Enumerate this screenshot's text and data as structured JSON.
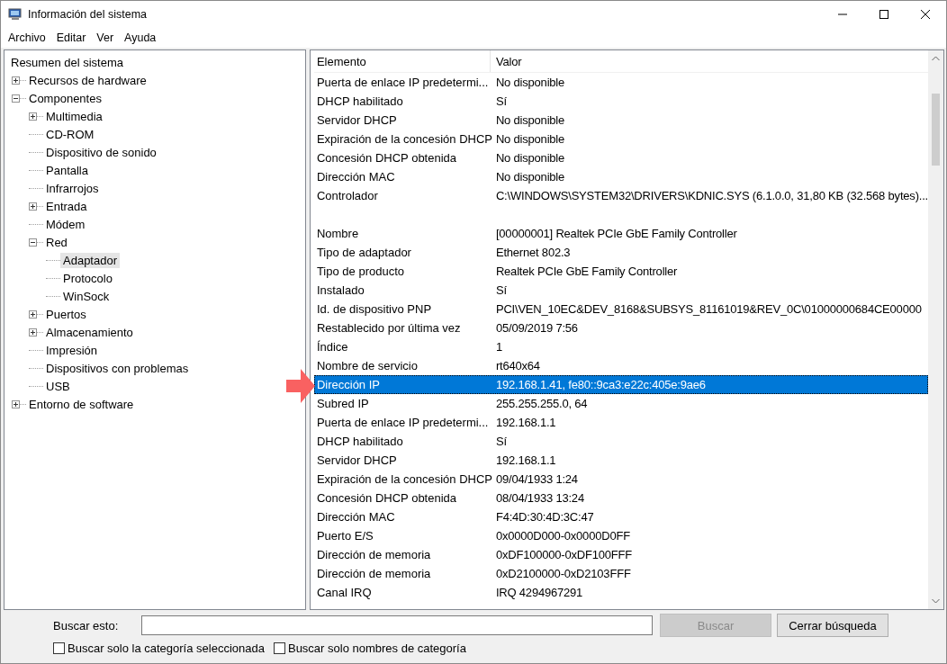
{
  "window": {
    "title": "Información del sistema"
  },
  "menu": [
    "Archivo",
    "Editar",
    "Ver",
    "Ayuda"
  ],
  "tree": [
    {
      "label": "Resumen del sistema",
      "selected": false,
      "children": [
        {
          "label": "Recursos de hardware",
          "expanded": false,
          "selected": false
        },
        {
          "label": "Componentes",
          "expanded": true,
          "selected": false,
          "children": [
            {
              "label": "Multimedia",
              "expanded": false,
              "selected": false
            },
            {
              "label": "CD-ROM",
              "selected": false
            },
            {
              "label": "Dispositivo de sonido",
              "selected": false
            },
            {
              "label": "Pantalla",
              "selected": false
            },
            {
              "label": "Infrarrojos",
              "selected": false
            },
            {
              "label": "Entrada",
              "expanded": false,
              "selected": false
            },
            {
              "label": "Módem",
              "selected": false
            },
            {
              "label": "Red",
              "expanded": true,
              "selected": false,
              "children": [
                {
                  "label": "Adaptador",
                  "selected": true
                },
                {
                  "label": "Protocolo",
                  "selected": false
                },
                {
                  "label": "WinSock",
                  "selected": false
                }
              ]
            },
            {
              "label": "Puertos",
              "expanded": false,
              "selected": false
            },
            {
              "label": "Almacenamiento",
              "expanded": false,
              "selected": false
            },
            {
              "label": "Impresión",
              "selected": false
            },
            {
              "label": "Dispositivos con problemas",
              "selected": false
            },
            {
              "label": "USB",
              "selected": false
            }
          ]
        },
        {
          "label": "Entorno de software",
          "expanded": false,
          "selected": false
        }
      ]
    }
  ],
  "table": {
    "columns": [
      "Elemento",
      "Valor"
    ],
    "rows": [
      {
        "kind": "data",
        "item": "Puerta de enlace IP predetermi...",
        "value": "No disponible",
        "selected": false
      },
      {
        "kind": "data",
        "item": "DHCP habilitado",
        "value": "Sí",
        "selected": false
      },
      {
        "kind": "data",
        "item": "Servidor DHCP",
        "value": "No disponible",
        "selected": false
      },
      {
        "kind": "data",
        "item": "Expiración de la concesión DHCP",
        "value": "No disponible",
        "selected": false
      },
      {
        "kind": "data",
        "item": "Concesión DHCP obtenida",
        "value": "No disponible",
        "selected": false
      },
      {
        "kind": "data",
        "item": "Dirección MAC",
        "value": "No disponible",
        "selected": false
      },
      {
        "kind": "data",
        "item": "Controlador",
        "value": "C:\\WINDOWS\\SYSTEM32\\DRIVERS\\KDNIC.SYS (6.1.0.0, 31,80 KB (32.568 bytes)...",
        "selected": false
      },
      {
        "kind": "spacer"
      },
      {
        "kind": "data",
        "item": "Nombre",
        "value": "[00000001] Realtek PCIe GbE Family Controller",
        "selected": false
      },
      {
        "kind": "data",
        "item": "Tipo de adaptador",
        "value": "Ethernet 802.3",
        "selected": false
      },
      {
        "kind": "data",
        "item": "Tipo de producto",
        "value": "Realtek PCIe GbE Family Controller",
        "selected": false
      },
      {
        "kind": "data",
        "item": "Instalado",
        "value": "Sí",
        "selected": false
      },
      {
        "kind": "data",
        "item": "Id. de dispositivo PNP",
        "value": "PCI\\VEN_10EC&DEV_8168&SUBSYS_81161019&REV_0C\\01000000684CE00000",
        "selected": false
      },
      {
        "kind": "data",
        "item": "Restablecido por última vez",
        "value": "05/09/2019 7:56",
        "selected": false
      },
      {
        "kind": "data",
        "item": "Índice",
        "value": "1",
        "selected": false
      },
      {
        "kind": "data",
        "item": "Nombre de servicio",
        "value": "rt640x64",
        "selected": false
      },
      {
        "kind": "data",
        "item": "Dirección IP",
        "value": "192.168.1.41, fe80::9ca3:e22c:405e:9ae6",
        "selected": true
      },
      {
        "kind": "data",
        "item": "Subred IP",
        "value": "255.255.255.0, 64",
        "selected": false
      },
      {
        "kind": "data",
        "item": "Puerta de enlace IP predetermi...",
        "value": "192.168.1.1",
        "selected": false
      },
      {
        "kind": "data",
        "item": "DHCP habilitado",
        "value": "Sí",
        "selected": false
      },
      {
        "kind": "data",
        "item": "Servidor DHCP",
        "value": "192.168.1.1",
        "selected": false
      },
      {
        "kind": "data",
        "item": "Expiración de la concesión DHCP",
        "value": "09/04/1933 1:24",
        "selected": false
      },
      {
        "kind": "data",
        "item": "Concesión DHCP obtenida",
        "value": "08/04/1933 13:24",
        "selected": false
      },
      {
        "kind": "data",
        "item": "Dirección MAC",
        "value": "F4:4D:30:4D:3C:47",
        "selected": false
      },
      {
        "kind": "data",
        "item": "Puerto E/S",
        "value": "0x0000D000-0x0000D0FF",
        "selected": false
      },
      {
        "kind": "data",
        "item": "Dirección de memoria",
        "value": "0xDF100000-0xDF100FFF",
        "selected": false
      },
      {
        "kind": "data",
        "item": "Dirección de memoria",
        "value": "0xD2100000-0xD2103FFF",
        "selected": false
      },
      {
        "kind": "data",
        "item": "Canal IRQ",
        "value": "IRQ 4294967291",
        "selected": false
      }
    ]
  },
  "search": {
    "label": "Buscar esto:",
    "find_button": {
      "label": "Buscar",
      "disabled": true
    },
    "close_button": {
      "label": "Cerrar búsqueda",
      "disabled": false
    }
  },
  "options": [
    {
      "label": "Buscar solo la categoría seleccionada",
      "checked": false
    },
    {
      "label": "Buscar solo nombres de categoría",
      "checked": false
    }
  ]
}
